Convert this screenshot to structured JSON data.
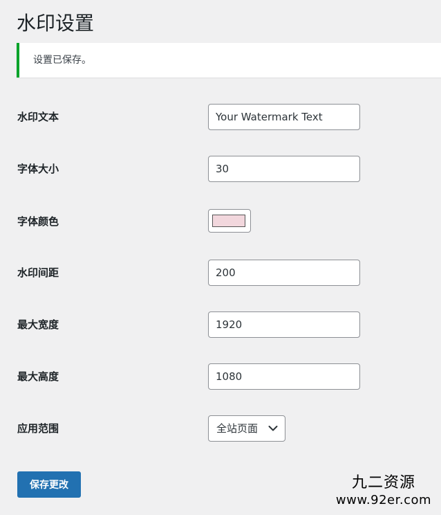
{
  "page": {
    "title": "水印设置"
  },
  "notice": {
    "text": "设置已保存。",
    "border_color": "#00a32a"
  },
  "form": {
    "fields": [
      {
        "label": "水印文本",
        "value": "Your Watermark Text"
      },
      {
        "label": "字体大小",
        "value": "30"
      },
      {
        "label": "字体颜色",
        "color": "#f2d7dd"
      },
      {
        "label": "水印间距",
        "value": "200"
      },
      {
        "label": "最大宽度",
        "value": "1920"
      },
      {
        "label": "最大高度",
        "value": "1080"
      },
      {
        "label": "应用范围",
        "selected": "全站页面",
        "icon": "chevron-down-icon"
      }
    ],
    "submit_label": "保存更改",
    "submit_color": "#2271b1"
  },
  "watermark": {
    "line1": "九二资源",
    "line2": "www.92er.com"
  }
}
